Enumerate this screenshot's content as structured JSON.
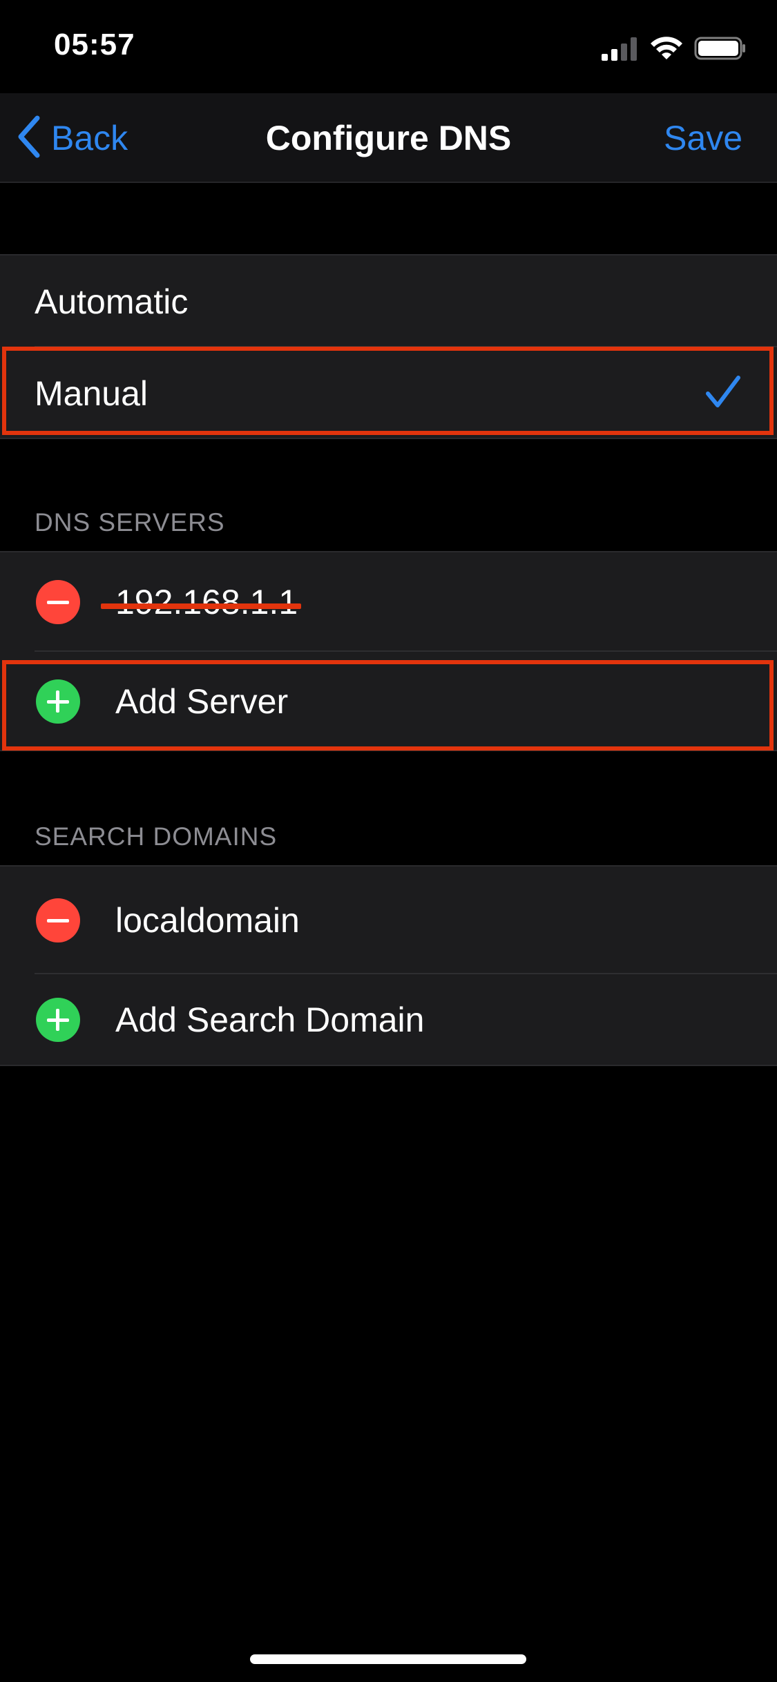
{
  "status_bar": {
    "time": "05:57",
    "icons": [
      "cellular-signal-icon",
      "wifi-icon",
      "battery-icon"
    ]
  },
  "nav": {
    "back_label": "Back",
    "title": "Configure DNS",
    "save_label": "Save"
  },
  "mode": {
    "options": [
      "Automatic",
      "Manual"
    ],
    "selected": "Manual"
  },
  "dns_servers": {
    "header": "DNS SERVERS",
    "servers": [
      "192.168.1.1"
    ],
    "add_label": "Add Server"
  },
  "search_domains": {
    "header": "SEARCH DOMAINS",
    "domains": [
      "localdomain"
    ],
    "add_label": "Add Search Domain"
  },
  "colors": {
    "accent": "#2f87f0",
    "delete": "#ff453a",
    "add": "#30d158",
    "annotation": "#e2340d"
  }
}
